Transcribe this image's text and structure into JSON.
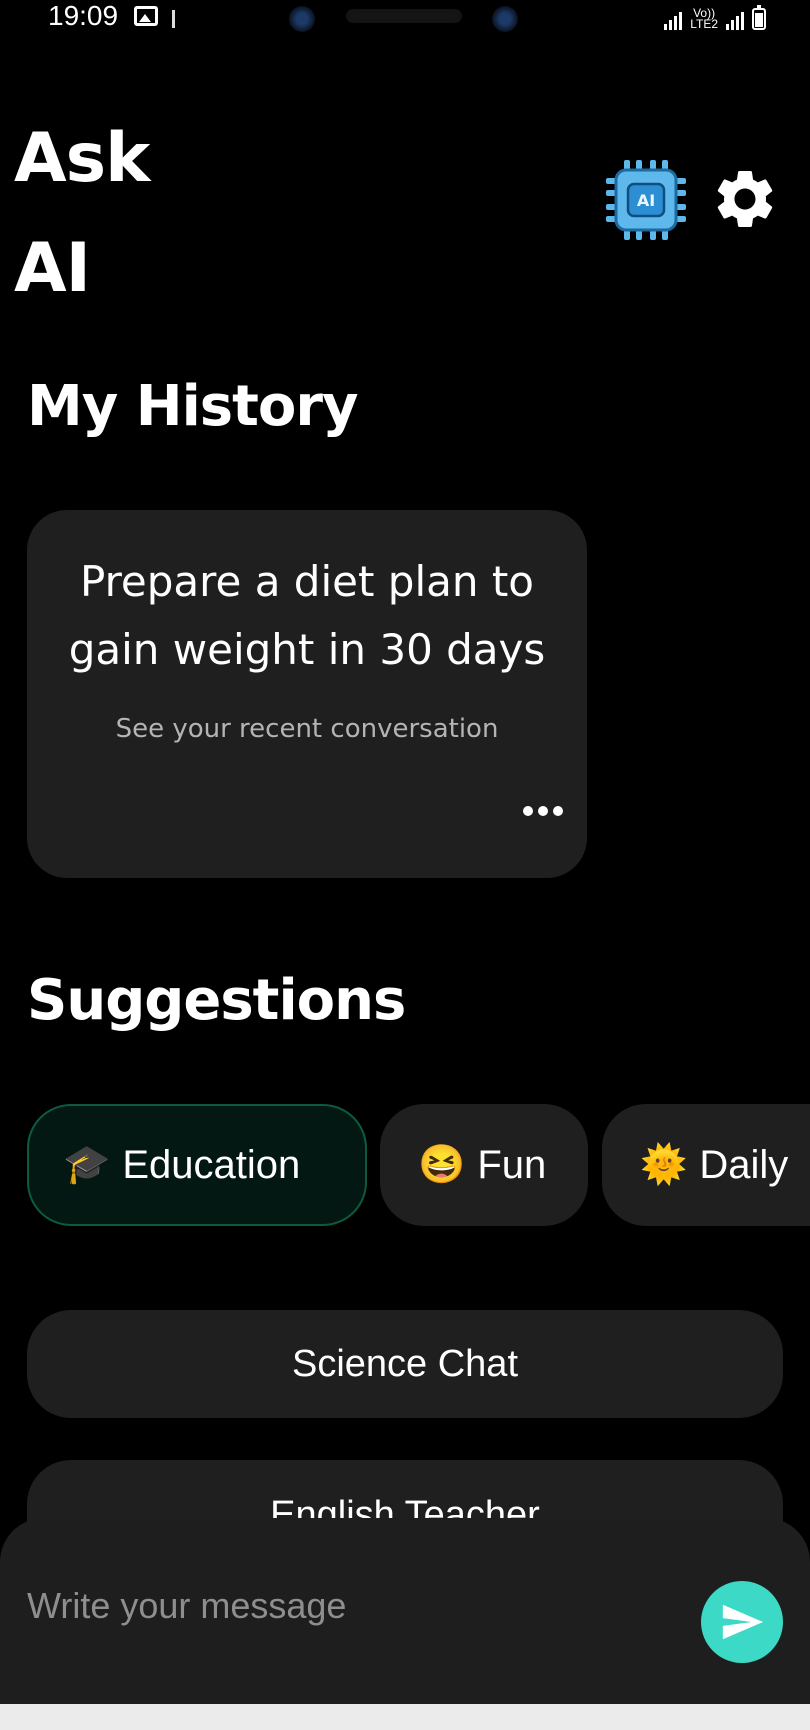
{
  "status_bar": {
    "time": "19:09",
    "network_label_top": "Vo))",
    "network_label_bottom": "LTE2",
    "battery_level": 0.85
  },
  "header": {
    "title": "Ask AI",
    "ai_chip_label": "AI",
    "ai_icon": "ai-chip-icon",
    "settings_icon": "gear-icon"
  },
  "history": {
    "title": "My History",
    "card": {
      "title": "Prepare a diet plan to gain weight in 30 days",
      "subtitle": "See your recent conversation",
      "more_icon": "more-horizontal-icon"
    }
  },
  "suggestions": {
    "title": "Suggestions",
    "categories": [
      {
        "emoji": "🎓",
        "label": "Education",
        "selected": true
      },
      {
        "emoji": "😆",
        "label": "Fun",
        "selected": false
      },
      {
        "emoji": "🌞",
        "label": "Daily",
        "selected": false
      }
    ],
    "items": [
      {
        "label": "Science Chat"
      },
      {
        "label": "English Teacher"
      }
    ]
  },
  "composer": {
    "placeholder": "Write your message",
    "send_icon": "send-icon"
  },
  "colors": {
    "background": "#000000",
    "card": "#1f1f1f",
    "accent": "#3bd9c6",
    "active_chip_border": "#0e5a3e",
    "chip_icon_blue": "#5fb8ec"
  }
}
